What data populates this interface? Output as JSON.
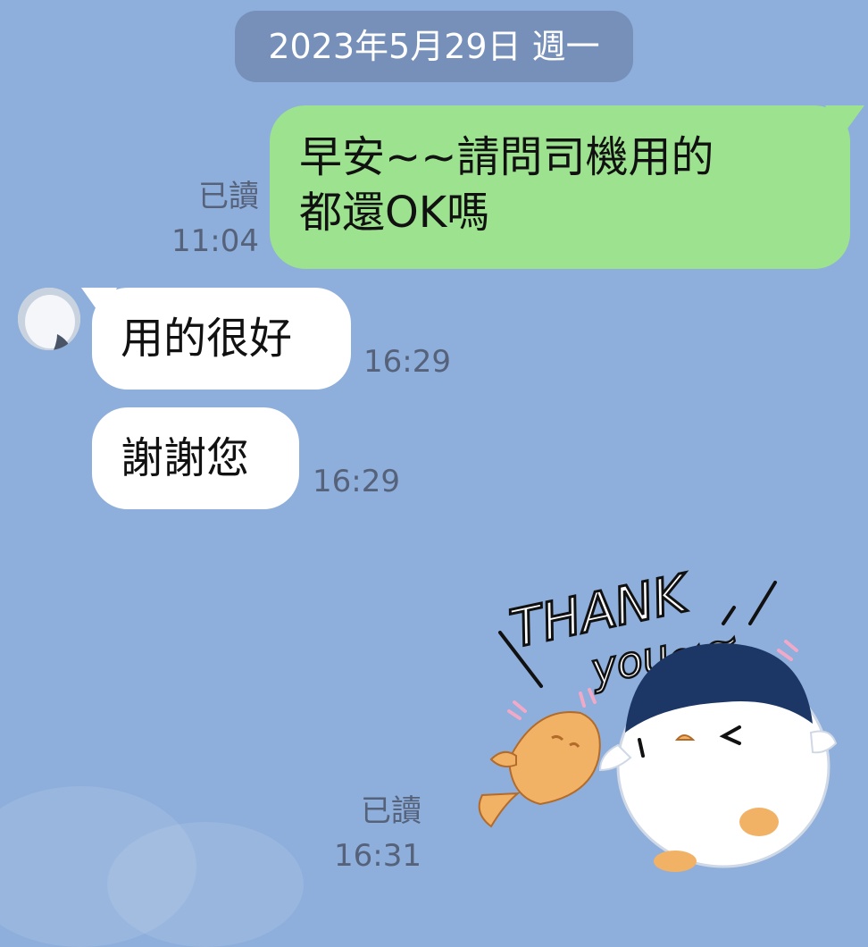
{
  "date_header": "2023年5月29日 週一",
  "messages": [
    {
      "direction": "outgoing",
      "lines": [
        "早安~~請問司機用的",
        "都還OK嗎"
      ],
      "read_label": "已讀",
      "time": "11:04"
    },
    {
      "direction": "incoming",
      "text": "用的很好",
      "time": "16:29"
    },
    {
      "direction": "incoming",
      "text": "謝謝您",
      "time": "16:29"
    },
    {
      "direction": "outgoing",
      "type": "sticker",
      "sticker_text": [
        "THANK",
        "you~~"
      ],
      "sticker_icon": "penguin-fish-thank-you-sticker",
      "read_label": "已讀",
      "time": "16:31"
    }
  ],
  "colors": {
    "background": "#8eaedb",
    "outgoing_bubble": "#9ce28f",
    "incoming_bubble": "#ffffff",
    "date_pill": "#7690ba"
  }
}
